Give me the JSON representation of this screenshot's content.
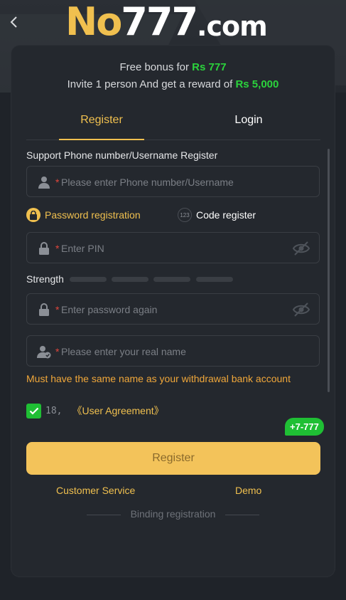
{
  "header": {
    "logo_no": "No",
    "logo_num": "777",
    "logo_domain": ".com"
  },
  "bonus": {
    "line1_text": "Free bonus for ",
    "line1_amount": "Rs 777",
    "line2_text": "Invite 1 person And get a reward of ",
    "line2_amount": "Rs 5,000"
  },
  "tabs": [
    {
      "label": "Register",
      "active": true
    },
    {
      "label": "Login",
      "active": false
    }
  ],
  "form": {
    "section_label": "Support Phone number/Username Register",
    "required_mark": "*",
    "phone_placeholder": "Please enter Phone number/Username",
    "modes": [
      {
        "label": "Password registration",
        "selected": true
      },
      {
        "label": "Code register",
        "selected": false,
        "badge": "123"
      }
    ],
    "pin_placeholder": "Enter PIN",
    "strength_label": "Strength",
    "strength_level": 0,
    "strength_segments": 4,
    "password_again_placeholder": "Enter password again",
    "real_name_placeholder": "Please enter your real name",
    "name_warning": "Must have the same name as your withdrawal bank account",
    "agree_checked": true,
    "age_text": "18,",
    "user_agreement": "《User Agreement》",
    "promo_badge": "+7-777",
    "submit_label": "Register"
  },
  "footer": {
    "customer_service": "Customer Service",
    "demo": "Demo",
    "binding": "Binding registration"
  },
  "colors": {
    "accent": "#f0c04f",
    "bonus_green": "#2bd33c",
    "warning": "#f0a73a",
    "required": "#e0463c"
  }
}
